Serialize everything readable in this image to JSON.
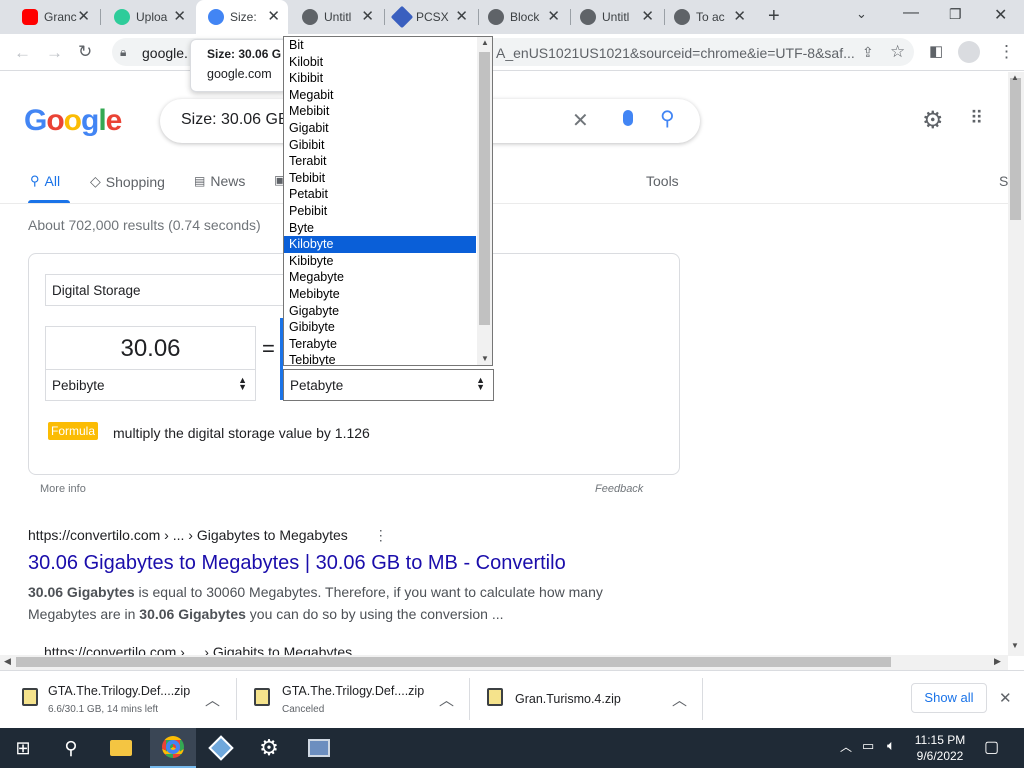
{
  "browser": {
    "tabs": [
      {
        "title": "Granc",
        "icon": "youtube-icon",
        "color": "#ff0000"
      },
      {
        "title": "Uploa",
        "icon": "upload-icon",
        "color": "#2ecc9a"
      },
      {
        "title": "Size:",
        "icon": "google-icon",
        "color": "#4285f4",
        "active": true
      },
      {
        "title": "Untitl",
        "icon": "globe-icon",
        "color": "#5f6368"
      },
      {
        "title": "PCSX",
        "icon": "pcsx-icon",
        "color": "#3a5fbf"
      },
      {
        "title": "Block",
        "icon": "globe-icon",
        "color": "#5f6368"
      },
      {
        "title": "Untitl",
        "icon": "globe-icon",
        "color": "#5f6368"
      },
      {
        "title": "To ac",
        "icon": "globe-icon",
        "color": "#5f6368"
      }
    ],
    "new_tab": "+",
    "omnibox_left": "google.",
    "omnibox_right": "A_enUS1021US1021&sourceid=chrome&ie=UTF-8&saf..."
  },
  "tooltip": {
    "title": "Size: 30.06 G",
    "domain": "google.com"
  },
  "search": {
    "logo": "Google",
    "query": "Size: 30.06 GB",
    "nav": {
      "all": "All",
      "shopping": "Shopping",
      "news": "News",
      "tools": "Tools",
      "cut": "S"
    },
    "result_stats": "About 702,000 results (0.74 seconds)"
  },
  "converter": {
    "category": "Digital Storage",
    "input_value": "30.06",
    "equals": "=",
    "from_unit": "Pebibyte",
    "to_unit": "Petabyte",
    "formula_badge": "Formula",
    "formula_text": "multiply the digital storage value by 1.126",
    "more_info": "More info",
    "feedback": "Feedback"
  },
  "dropdown": {
    "options": [
      "Bit",
      "Kilobit",
      "Kibibit",
      "Megabit",
      "Mebibit",
      "Gigabit",
      "Gibibit",
      "Terabit",
      "Tebibit",
      "Petabit",
      "Pebibit",
      "Byte",
      "Kilobyte",
      "Kibibyte",
      "Megabyte",
      "Mebibyte",
      "Gigabyte",
      "Gibibyte",
      "Terabyte",
      "Tebibyte"
    ],
    "highlighted": "Kilobyte"
  },
  "results": [
    {
      "url": "https://convertilo.com › ... › Gigabytes to Megabytes",
      "title": "30.06 Gigabytes to Megabytes | 30.06 GB to MB - Convertilo",
      "snippet_b1": "30.06 Gigabytes",
      "snippet_t1": " is equal to 30060 Megabytes. Therefore, if you want to calculate how many Megabytes are in ",
      "snippet_b2": "30.06 Gigabytes",
      "snippet_t2": " you can do so by using the conversion ..."
    },
    {
      "url": "https://convertilo.com › ... › Gigabits to Megabytes"
    }
  ],
  "downloads": {
    "items": [
      {
        "name": "GTA.The.Trilogy.Def....zip",
        "status": "6.6/30.1 GB, 14 mins left"
      },
      {
        "name": "GTA.The.Trilogy.Def....zip",
        "status": "Canceled"
      },
      {
        "name": "Gran.Turismo.4.zip",
        "status": ""
      }
    ],
    "show_all": "Show all"
  },
  "taskbar": {
    "time": "11:15 PM",
    "date": "9/6/2022"
  }
}
